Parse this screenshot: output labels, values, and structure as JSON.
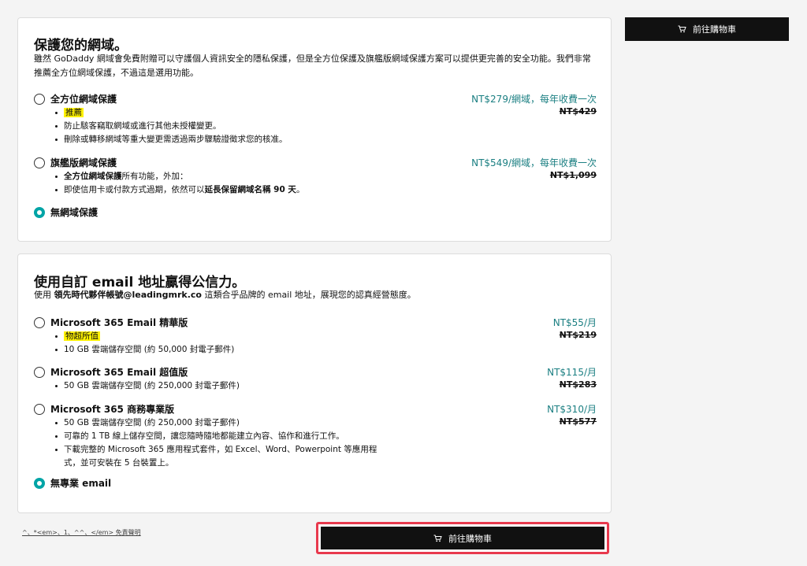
{
  "privacy": {
    "title": "保護您的網域。",
    "desc": "雖然 GoDaddy 網域會免費附贈可以守護個人資訊安全的隱私保護，但是全方位保護及旗艦版網域保護方案可以提供更完善的安全功能。我們非常推薦全方位網域保護，不過這是選用功能。",
    "options": [
      {
        "name": "全方位網域保護",
        "price": "NT$279/網域，每年收費一次",
        "old_price": "NT$429",
        "badge": "推薦",
        "bullets": [
          "防止駭客竊取網域或進行其他未授權變更。",
          "刪除或轉移網域等重大變更需透過兩步驟驗證徵求您的核准。"
        ],
        "selected": false
      },
      {
        "name": "旗艦版網域保護",
        "price": "NT$549/網域，每年收費一次",
        "old_price": "NT$1,099",
        "bullet1_bold": "全方位網域保護",
        "bullet1_rest": "所有功能，外加：",
        "bullet2_pre": "即使信用卡或付款方式過期，依然可以",
        "bullet2_bold": "延長保留網域名稱 90 天",
        "bullet2_post": "。",
        "selected": false
      },
      {
        "name": "無網域保護",
        "selected": true
      }
    ]
  },
  "email": {
    "title": "使用自訂 email 地址贏得公信力。",
    "desc_pre": "使用 ",
    "desc_bold": "領先時代夥伴帳號@leadingmrk.co",
    "desc_post": " 這類合乎品牌的 email 地址，展現您的認真經營態度。",
    "options": [
      {
        "name": "Microsoft 365 Email 精華版",
        "price": "NT$55/月",
        "old_price": "NT$219",
        "badge": "物超所值",
        "bullets": [
          "10 GB 雲端儲存空間 (約 50,000 封電子郵件)"
        ],
        "selected": false
      },
      {
        "name": "Microsoft 365 Email 超值版",
        "price": "NT$115/月",
        "old_price": "NT$283",
        "bullets": [
          "50 GB 雲端儲存空間 (約 250,000 封電子郵件)"
        ],
        "selected": false
      },
      {
        "name": "Microsoft 365 商務專業版",
        "price": "NT$310/月",
        "old_price": "NT$577",
        "bullets": [
          "50 GB 雲端儲存空間 (約 250,000 封電子郵件)",
          "可靠的 1 TB 線上儲存空間，讓您隨時隨地都能建立內容、協作和進行工作。",
          "下載完整的 Microsoft 365 應用程式套件，如 Excel、Word、Powerpoint 等應用程",
          "式，並可安裝在 5 台裝置上。"
        ],
        "selected": false
      },
      {
        "name": "無專業 email",
        "selected": true
      }
    ]
  },
  "cart_button_label": "前往購物車",
  "footer_disclaimer": "^、*<em>、1、^^、</em> 免責聲明",
  "colors": {
    "accent": "#00a4a6",
    "price": "#1b7f82",
    "highlight": "#fff200",
    "focus_border": "#e8394d"
  }
}
